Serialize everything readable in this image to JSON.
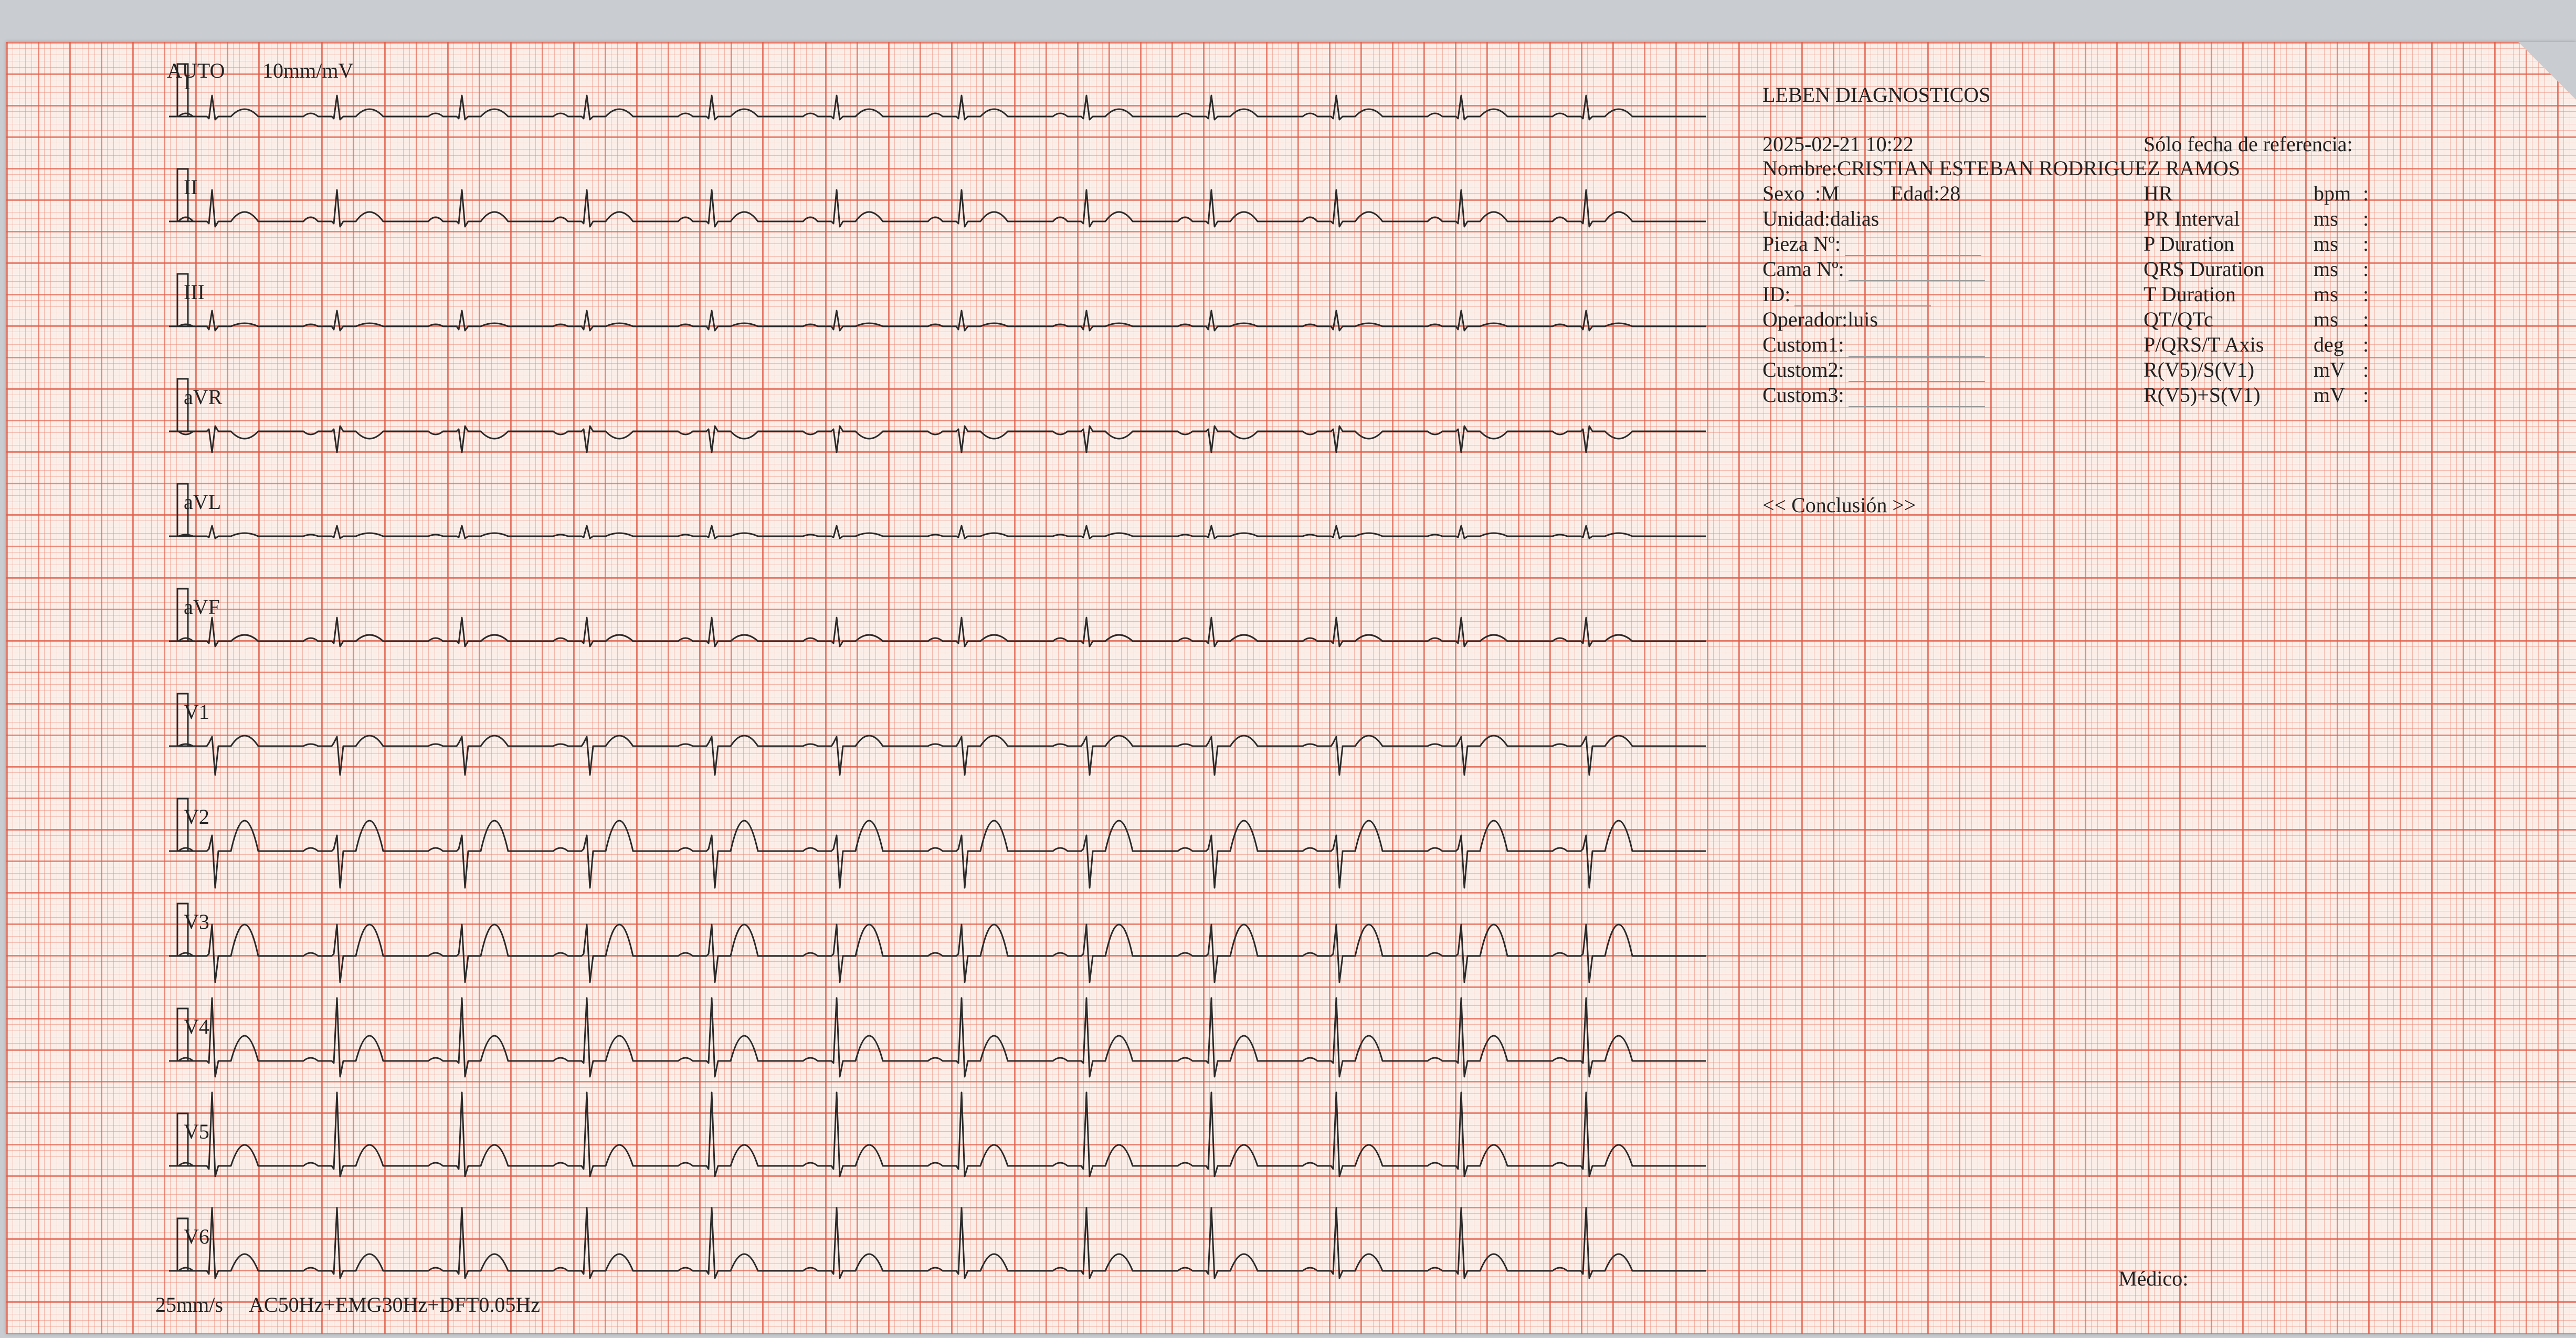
{
  "header": {
    "mode": "AUTO",
    "gain": "10mm/mV"
  },
  "leads": [
    "I",
    "II",
    "III",
    "aVR",
    "aVL",
    "aVF",
    "V1",
    "V2",
    "V3",
    "V4",
    "V5",
    "V6"
  ],
  "footer": {
    "speed": "25mm/s",
    "filters": "AC50Hz+EMG30Hz+DFT0.05Hz",
    "doctor_label": "Médico:"
  },
  "info": {
    "company": "LEBEN DIAGNOSTICOS",
    "datetime": "2025-02-21 10:22",
    "reference_note": "Sólo fecha de referencia:",
    "name": "Nombre:CRISTIAN ESTEBAN RODRIGUEZ RAMOS",
    "sex": "Sexo  :M",
    "age": "Edad:28",
    "unit": "Unidad:dalias",
    "room": "Pieza Nº:",
    "bed": "Cama Nº:",
    "id": "ID:",
    "operator": "Operador:luis",
    "custom1": "Custom1:",
    "custom2": "Custom2:",
    "custom3": "Custom3:",
    "conclusion": "<< Conclusión >>"
  },
  "measurements": [
    {
      "label": "HR",
      "unit": "bpm",
      "sep": ":"
    },
    {
      "label": "PR Interval",
      "unit": "ms",
      "sep": ":"
    },
    {
      "label": "P Duration",
      "unit": "ms",
      "sep": ":"
    },
    {
      "label": "QRS Duration",
      "unit": "ms",
      "sep": ":"
    },
    {
      "label": "T Duration",
      "unit": "ms",
      "sep": ":"
    },
    {
      "label": "QT/QTc",
      "unit": "ms",
      "sep": ":"
    },
    {
      "label": "P/QRS/T Axis",
      "unit": "deg",
      "sep": ":"
    },
    {
      "label": "R(V5)/S(V1)",
      "unit": "mV",
      "sep": ":"
    },
    {
      "label": "R(V5)+S(V1)",
      "unit": "mV",
      "sep": ":"
    }
  ],
  "colors": {
    "trace": "#2a2a2a",
    "grid_major": "#e25c48",
    "paper": "#fbeee8"
  }
}
